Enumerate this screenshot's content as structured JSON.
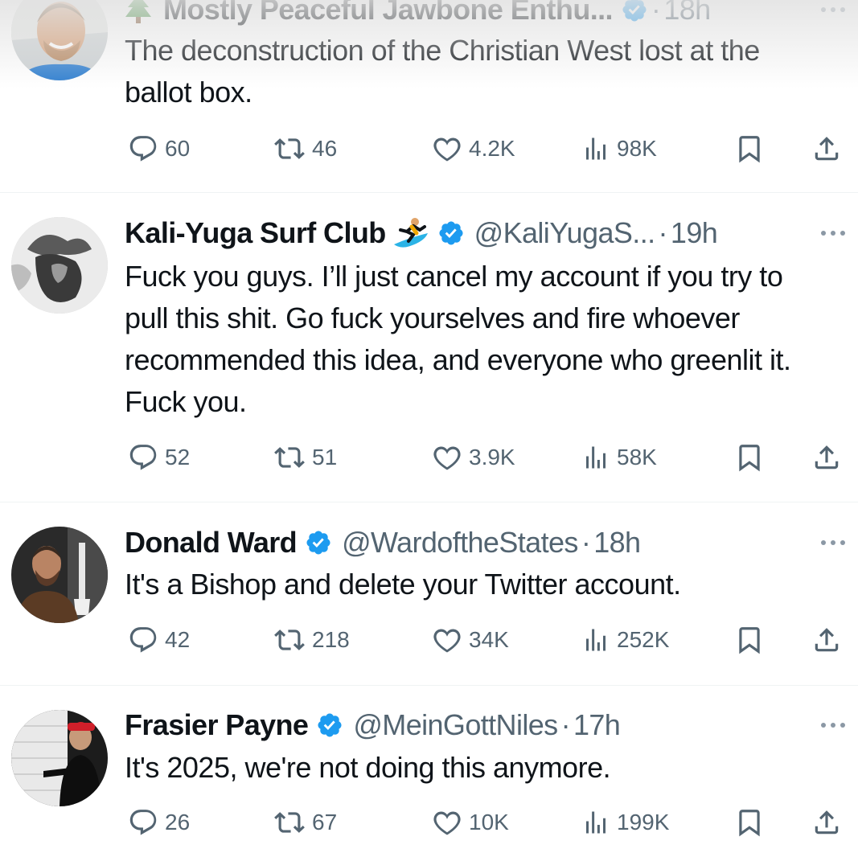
{
  "tweets": [
    {
      "name": "Mostly Peaceful Jawbone Enthu...",
      "name_prefix_icon": "tree-emoji",
      "handle": "",
      "dot": "·",
      "time": "18h",
      "text": "The deconstruction of the Christian West lost at the ballot box.",
      "counts": {
        "replies": "60",
        "reposts": "46",
        "likes": "4.2K",
        "views": "98K"
      }
    },
    {
      "name": "Kali-Yuga Surf Club",
      "name_suffix_icon": "surfer-emoji",
      "handle": "@KaliYugaS...",
      "dot": "·",
      "time": "19h",
      "text": "Fuck you guys. I’ll just cancel my account if you try to pull this shit. Go fuck yourselves and fire whoever recommended this idea, and everyone who greenlit it. Fuck you.",
      "counts": {
        "replies": "52",
        "reposts": "51",
        "likes": "3.9K",
        "views": "58K"
      }
    },
    {
      "name": "Donald Ward",
      "handle": "@WardoftheStates",
      "dot": "·",
      "time": "18h",
      "text": "It's a Bishop and delete your Twitter account.",
      "counts": {
        "replies": "42",
        "reposts": "218",
        "likes": "34K",
        "views": "252K"
      }
    },
    {
      "name": "Frasier Payne",
      "handle": "@MeinGottNiles",
      "dot": "·",
      "time": "17h",
      "text": "It's 2025, we're not doing this anymore.",
      "counts": {
        "replies": "26",
        "reposts": "67",
        "likes": "10K",
        "views": "199K"
      }
    }
  ],
  "icons": {
    "reply": "reply-icon",
    "repost": "repost-icon",
    "like": "heart-icon",
    "views": "views-icon",
    "bookmark": "bookmark-icon",
    "share": "share-icon",
    "verified": "verified-badge-icon",
    "more": "more-options-icon"
  },
  "colors": {
    "verified": "#1d9bf0",
    "text": "#0f1419",
    "secondary": "#536471"
  }
}
